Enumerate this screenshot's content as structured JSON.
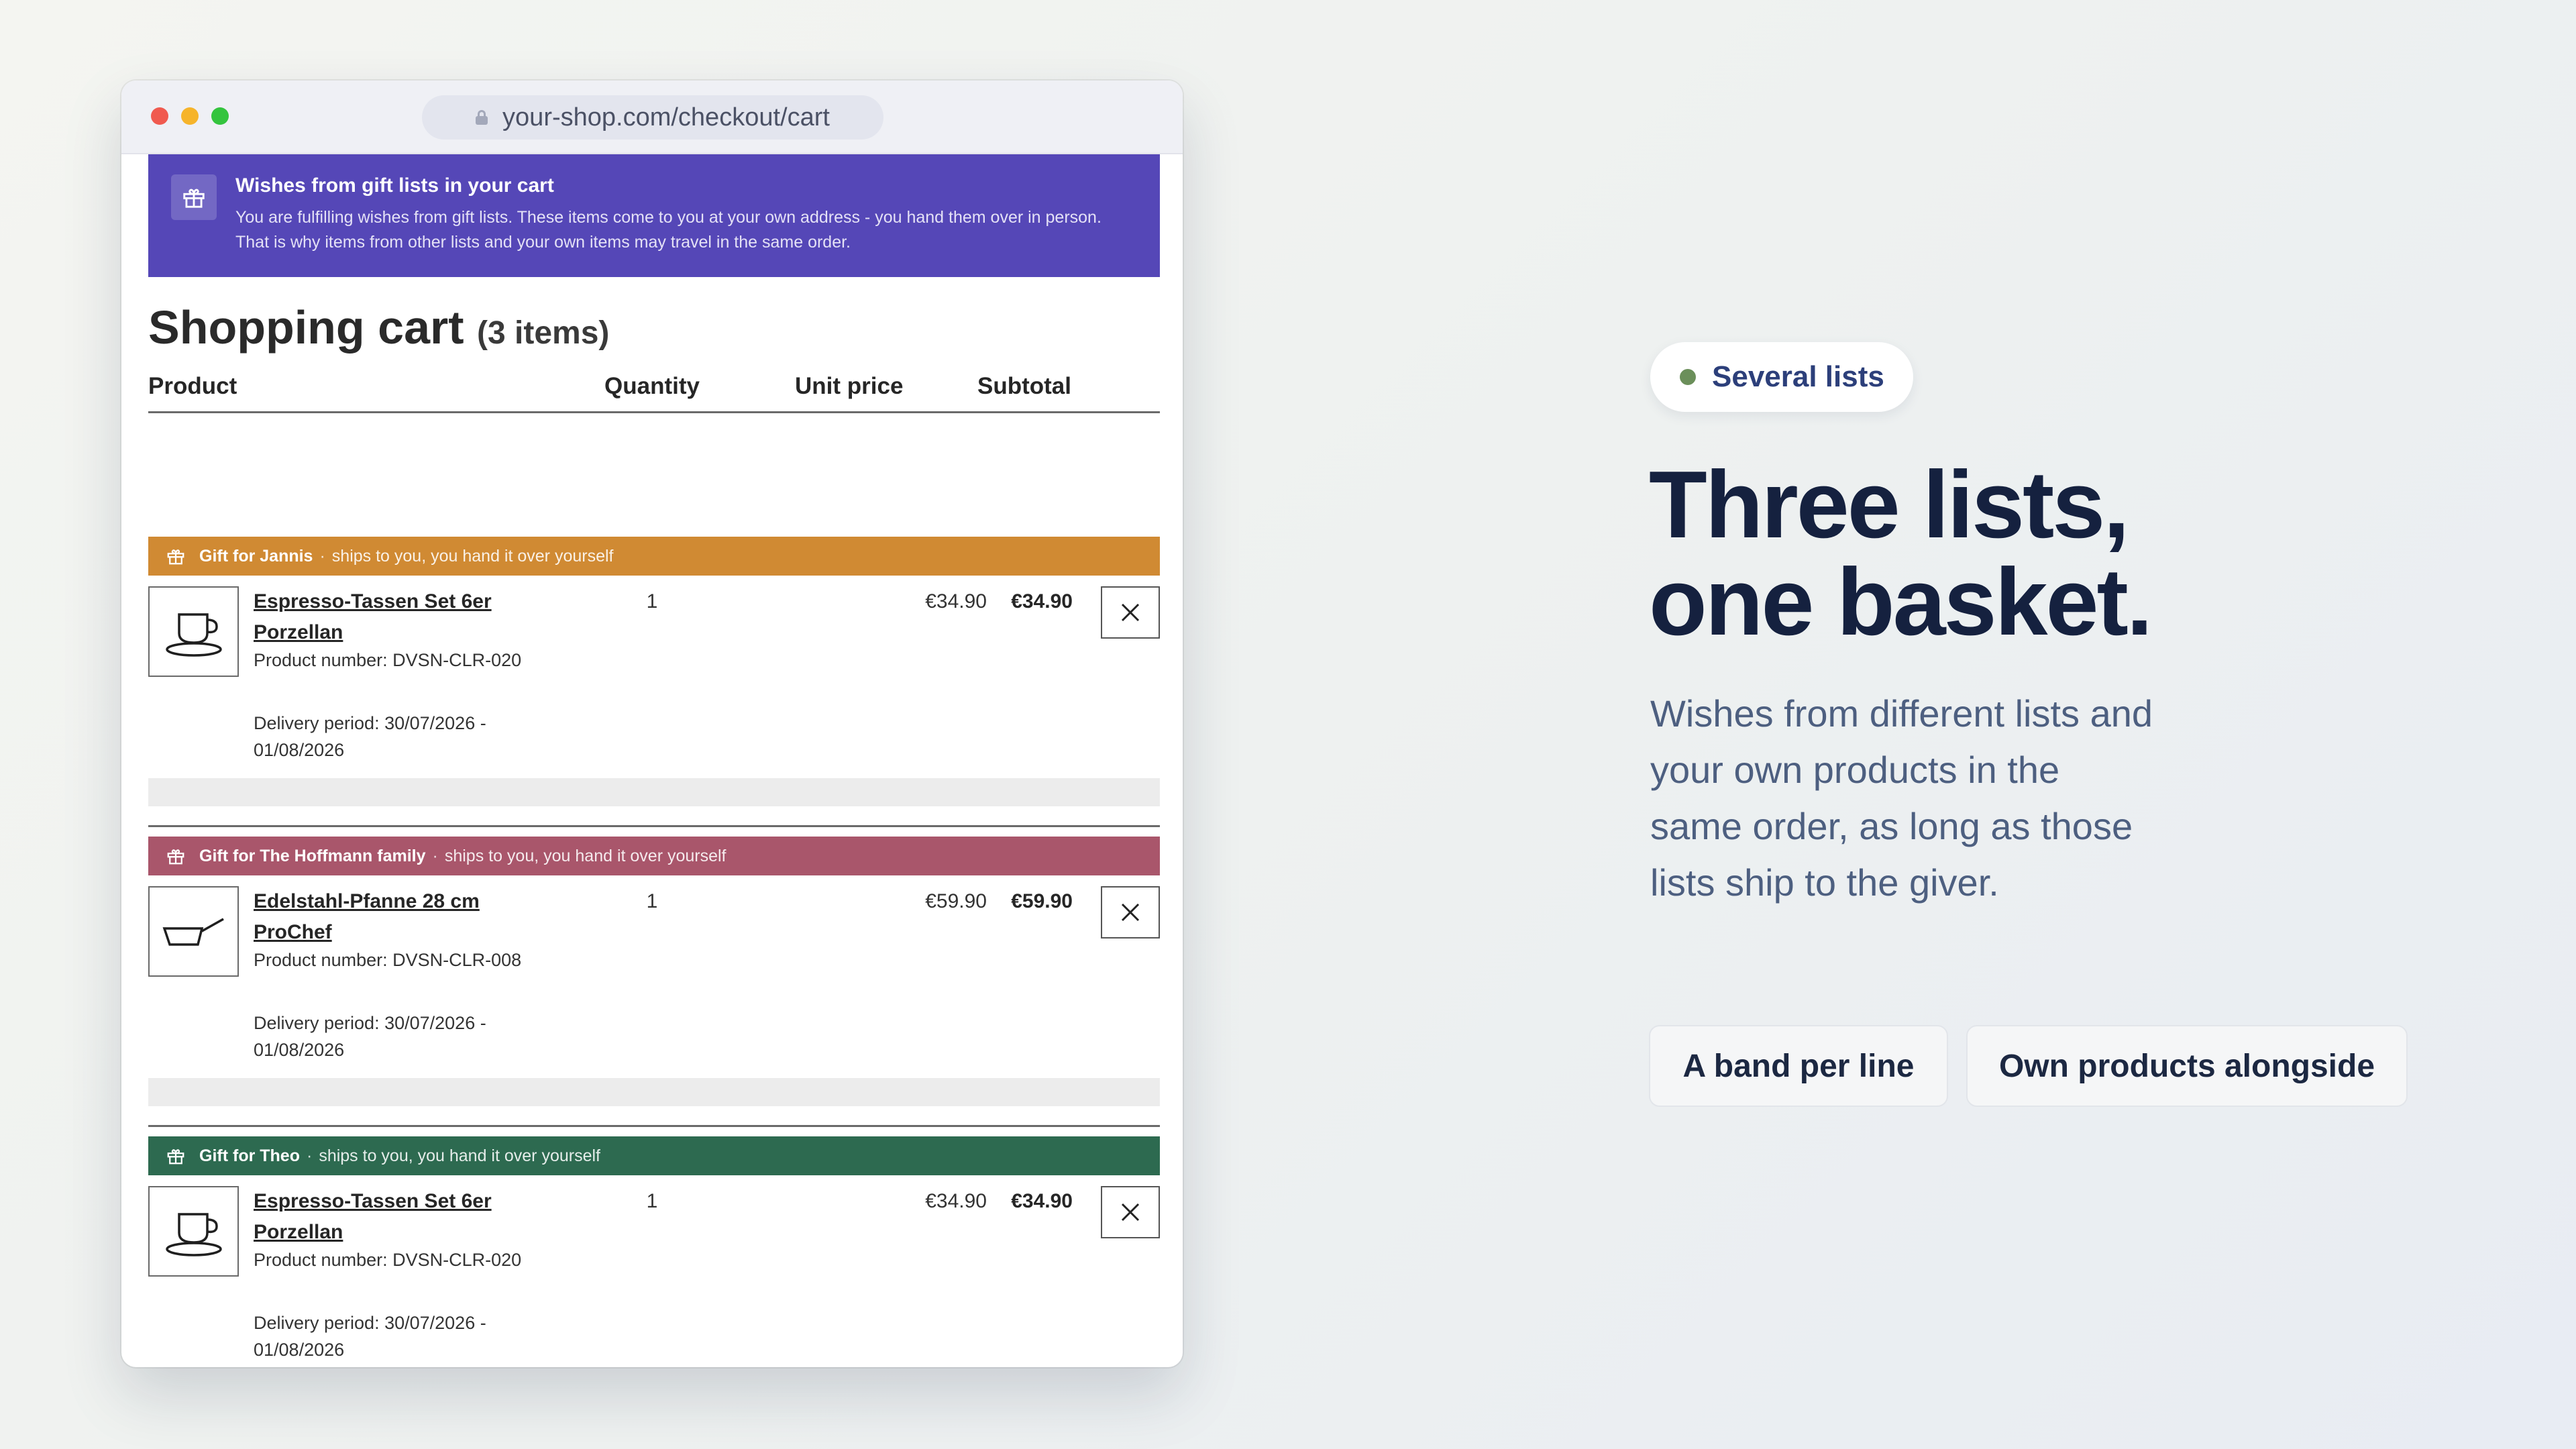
{
  "browser": {
    "url": "your-shop.com/checkout/cart"
  },
  "banner": {
    "title": "Wishes from gift lists in your cart",
    "text": "You are fulfilling wishes from gift lists. These items come to you at your own address - you hand them over in person. That is why items from other lists and your own items may travel in the same order."
  },
  "cart": {
    "title": "Shopping cart",
    "count": "(3 items)",
    "columns": {
      "product": "Product",
      "quantity": "Quantity",
      "unit_price": "Unit price",
      "subtotal": "Subtotal"
    },
    "items": [
      {
        "band_label": "Gift for Jannis",
        "band_separator": "·",
        "band_note": "ships to you, you hand it over yourself",
        "band_color": "#d08a33",
        "icon": "cup-icon",
        "name": "Espresso-Tassen Set 6er Porzellan",
        "product_number": "Product number: DVSN-CLR-020",
        "delivery": "Delivery period: 30/07/2026 - 01/08/2026",
        "quantity": "1",
        "unit_price": "€34.90",
        "subtotal": "€34.90"
      },
      {
        "band_label": "Gift for The Hoffmann family",
        "band_separator": "·",
        "band_note": "ships to you, you hand it over yourself",
        "band_color": "#a9566b",
        "icon": "pan-icon",
        "name": "Edelstahl-Pfanne 28 cm ProChef",
        "product_number": "Product number: DVSN-CLR-008",
        "delivery": "Delivery period: 30/07/2026 - 01/08/2026",
        "quantity": "1",
        "unit_price": "€59.90",
        "subtotal": "€59.90"
      },
      {
        "band_label": "Gift for Theo",
        "band_separator": "·",
        "band_note": "ships to you, you hand it over yourself",
        "band_color": "#2d6a50",
        "icon": "cup-icon",
        "name": "Espresso-Tassen Set 6er Porzellan",
        "product_number": "Product number: DVSN-CLR-020",
        "delivery": "Delivery period: 30/07/2026 - 01/08/2026",
        "quantity": "1",
        "unit_price": "€34.90",
        "subtotal": "€34.90"
      }
    ]
  },
  "promo": {
    "pill": "Several lists",
    "headline_line1": "Three lists,",
    "headline_line2": "one basket.",
    "subtext": "Wishes from different lists and your own products in the same order, as long as those lists ship to the giver.",
    "chips": [
      "A band per line",
      "Own products alongside"
    ]
  },
  "colors": {
    "banner": "#5547b7",
    "headline": "#15213f",
    "pill_text": "#2c3f7a",
    "pill_dot": "#6b8f5a"
  }
}
